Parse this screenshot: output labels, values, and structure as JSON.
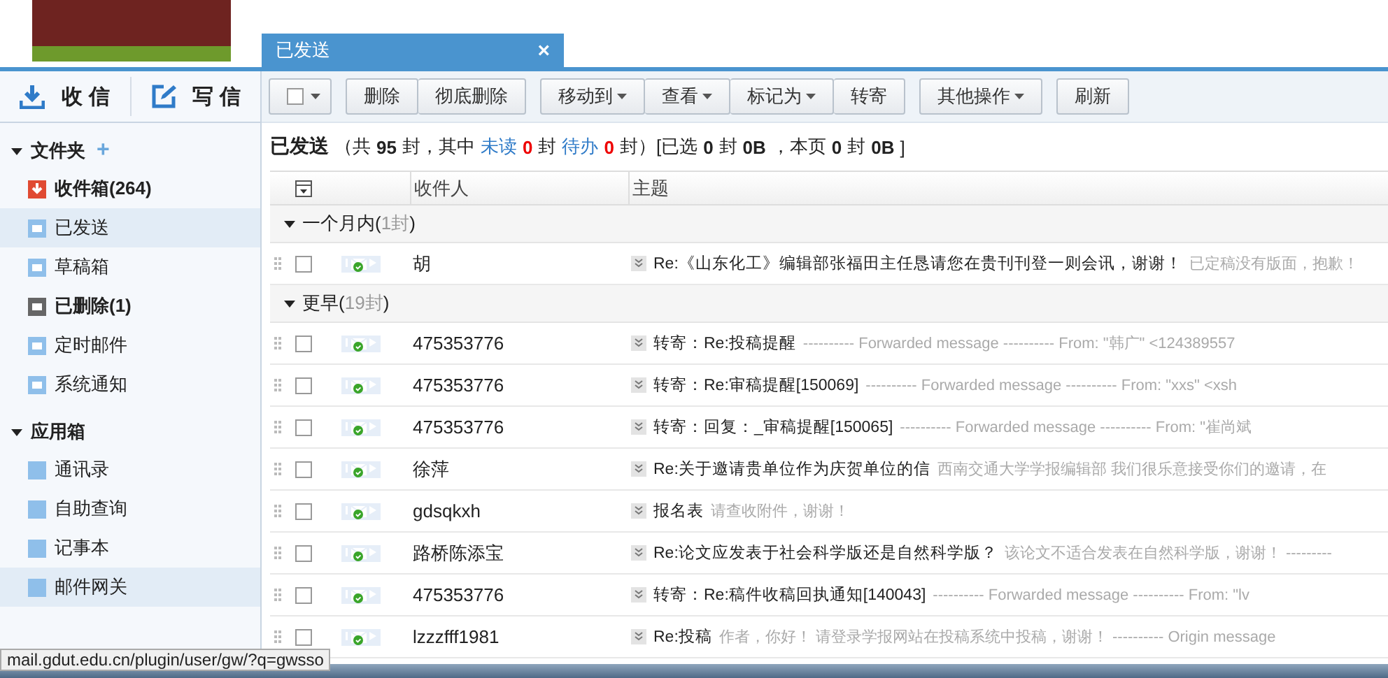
{
  "tab": {
    "title": "已发送",
    "close": "×"
  },
  "compose": [
    {
      "kind": "receive",
      "label": "收 信"
    },
    {
      "kind": "write",
      "label": "写 信"
    }
  ],
  "sidebar": {
    "groups": [
      {
        "title": "文件夹",
        "add": "+",
        "expanded": true,
        "items": [
          {
            "kind": "inbox",
            "label": "收件箱",
            "count": "(264)",
            "unread": true,
            "selected": false
          },
          {
            "kind": "folder",
            "label": "已发送",
            "unread": false,
            "selected": true
          },
          {
            "kind": "folder",
            "label": "草稿箱",
            "unread": false,
            "selected": false
          },
          {
            "kind": "trash",
            "label": "已删除",
            "count": "(1)",
            "unread": true,
            "selected": false
          },
          {
            "kind": "folder",
            "label": "定时邮件",
            "unread": false,
            "selected": false
          },
          {
            "kind": "folder",
            "label": "系统通知",
            "unread": false,
            "selected": false
          }
        ]
      },
      {
        "title": "应用箱",
        "expanded": true,
        "items": [
          {
            "kind": "app",
            "label": "通讯录",
            "unread": false,
            "selected": false
          },
          {
            "kind": "app",
            "label": "自助查询",
            "unread": false,
            "selected": false
          },
          {
            "kind": "app",
            "label": "记事本",
            "unread": false,
            "selected": false
          },
          {
            "kind": "app",
            "label": "邮件网关",
            "unread": false,
            "selected": true
          }
        ]
      }
    ]
  },
  "toolbar": {
    "select_all": {
      "checked": false
    },
    "groups": [
      [
        {
          "label": "删除",
          "dropdown": false
        },
        {
          "label": "彻底删除",
          "dropdown": false
        }
      ],
      [
        {
          "label": "移动到",
          "dropdown": true
        },
        {
          "label": "查看",
          "dropdown": true
        },
        {
          "label": "标记为",
          "dropdown": true
        },
        {
          "label": "转寄",
          "dropdown": false
        }
      ],
      [
        {
          "label": "其他操作",
          "dropdown": true
        }
      ],
      [
        {
          "label": "刷新",
          "dropdown": false
        }
      ]
    ]
  },
  "summary": {
    "title": "已发送",
    "segments": [
      {
        "kind": "text",
        "text": "（共"
      },
      {
        "kind": "strong",
        "text": "95"
      },
      {
        "kind": "text",
        "text": "封，其中"
      },
      {
        "kind": "link",
        "text": "未读"
      },
      {
        "kind": "alert",
        "text": "0"
      },
      {
        "kind": "text",
        "text": "封"
      },
      {
        "kind": "link",
        "text": "待办"
      },
      {
        "kind": "alert",
        "text": "0"
      },
      {
        "kind": "text",
        "text": "封）[已选"
      },
      {
        "kind": "strong",
        "text": "0"
      },
      {
        "kind": "text",
        "text": "封"
      },
      {
        "kind": "strong",
        "text": "0B"
      },
      {
        "kind": "text",
        "text": "，本页"
      },
      {
        "kind": "strong",
        "text": "0"
      },
      {
        "kind": "text",
        "text": "封"
      },
      {
        "kind": "strong",
        "text": "0B"
      },
      {
        "kind": "text",
        "text": "]"
      }
    ]
  },
  "table": {
    "columns": [
      "收件人",
      "主题"
    ],
    "groups": [
      {
        "title": "一个月内",
        "brackets": [
          "(",
          ")"
        ],
        "count": "1封",
        "expanded": true,
        "rows": [
          {
            "checked": false,
            "recipient": "胡",
            "subject": "Re:《山东化工》编辑部张福田主任恳请您在贵刊刊登一则会讯，谢谢！",
            "preview": "已定稿没有版面，抱歉！"
          }
        ]
      },
      {
        "title": "更早",
        "brackets": [
          "(",
          ")"
        ],
        "count": "19封",
        "expanded": true,
        "rows": [
          {
            "checked": false,
            "recipient": "475353776",
            "subject": "转寄：Re:投稿提醒",
            "preview": "---------- Forwarded message ---------- From: \"韩广\" <124389557"
          },
          {
            "checked": false,
            "recipient": "475353776",
            "subject": "转寄：Re:审稿提醒[150069]",
            "preview": "---------- Forwarded message ---------- From: \"xxs\" <xsh"
          },
          {
            "checked": false,
            "recipient": "475353776",
            "subject": "转寄：回复：_审稿提醒[150065]",
            "preview": "---------- Forwarded message ---------- From: \"崔尚斌"
          },
          {
            "checked": false,
            "recipient": "徐萍",
            "subject": "Re:关于邀请贵单位作为庆贺单位的信",
            "preview": "西南交通大学学报编辑部 我们很乐意接受你们的邀请，在"
          },
          {
            "checked": false,
            "recipient": "gdsqkxh",
            "subject": "报名表",
            "preview": "请查收附件，谢谢！"
          },
          {
            "checked": false,
            "recipient": "路桥陈添宝",
            "subject": "Re:论文应发表于社会科学版还是自然科学版？",
            "preview": "该论文不适合发表在自然科学版，谢谢！ ---------"
          },
          {
            "checked": false,
            "recipient": "475353776",
            "subject": "转寄：Re:稿件收稿回执通知[140043]",
            "preview": "---------- Forwarded message ---------- From: \"lv"
          },
          {
            "checked": false,
            "recipient": "lzzzfff1981",
            "subject": "Re:投稿",
            "preview": "作者，你好！ 请登录学报网站在投稿系统中投稿，谢谢！ ---------- Origin message"
          }
        ]
      }
    ]
  },
  "status_bar": {
    "url": "mail.gdut.edu.cn/plugin/user/gw/?q=gwsso"
  }
}
